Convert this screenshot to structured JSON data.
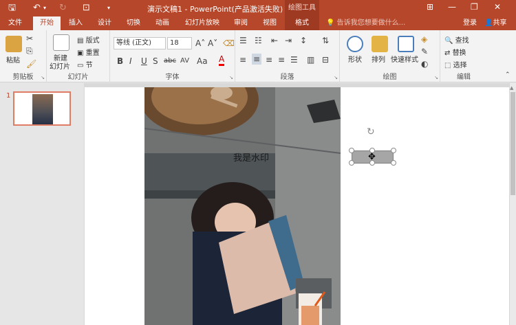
{
  "app": {
    "title": "演示文稿1 - PowerPoint(产品激活失败)",
    "context_tab_group": "绘图工具",
    "accent": "#b7472a"
  },
  "tabs": [
    {
      "label": "文件"
    },
    {
      "label": "开始"
    },
    {
      "label": "插入"
    },
    {
      "label": "设计"
    },
    {
      "label": "切换"
    },
    {
      "label": "动画"
    },
    {
      "label": "幻灯片放映"
    },
    {
      "label": "审阅"
    },
    {
      "label": "视图"
    },
    {
      "label": "格式"
    }
  ],
  "tell_me": "告诉我您想要做什么...",
  "account": {
    "login": "登录",
    "share": "共享"
  },
  "ribbon": {
    "clipboard": {
      "paste": "粘贴",
      "label": "剪贴板"
    },
    "slides": {
      "new_slide_line1": "新建",
      "new_slide_line2": "幻灯片",
      "layout": "版式",
      "reset": "重置",
      "section": "节",
      "label": "幻灯片"
    },
    "font": {
      "name": "等线 (正文)",
      "size": "18",
      "bold": "B",
      "italic": "I",
      "underline": "U",
      "strike": "S",
      "shadow": "abc",
      "spacing": "AV",
      "case": "Aa",
      "label": "字体"
    },
    "paragraph": {
      "label": "段落"
    },
    "drawing": {
      "shapes": "形状",
      "arrange": "排列",
      "quick_styles": "快速样式",
      "label": "绘图"
    },
    "editing": {
      "find": "查找",
      "replace": "替换",
      "select": "选择",
      "label": "编辑"
    }
  },
  "thumbnails": [
    {
      "number": "1"
    }
  ],
  "slide": {
    "watermark_text": "我是水印"
  }
}
